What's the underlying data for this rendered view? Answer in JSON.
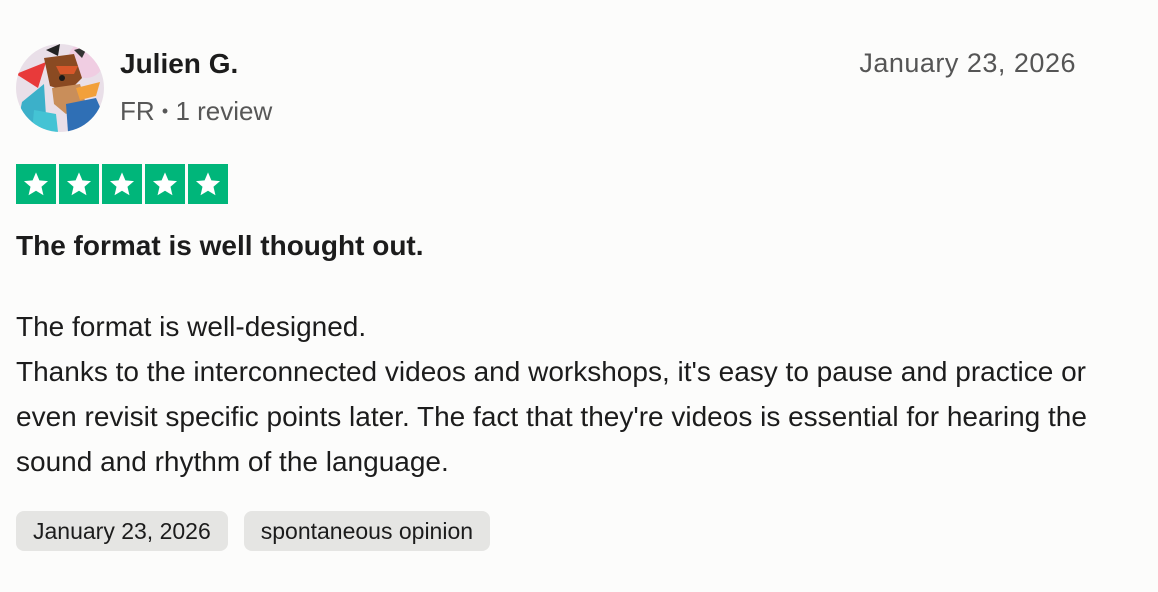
{
  "reviewer": {
    "name": "Julien G.",
    "country": "FR",
    "separator": "•",
    "review_count": "1 review"
  },
  "review": {
    "date": "January 23, 2026",
    "rating": 5,
    "rating_max": 5,
    "star_color": "#00b67a",
    "title": "The format is well thought out.",
    "body_lines": [
      "The format is well-designed.",
      "Thanks to the interconnected videos and workshops, it's easy to pause and practice or even revisit specific points later. The fact that they're videos is essential for hearing the sound and rhythm of the language."
    ]
  },
  "tags": [
    {
      "label": "January 23, 2026"
    },
    {
      "label": "spontaneous opinion"
    }
  ],
  "icons": {
    "star": "star-icon",
    "avatar": "avatar-image"
  }
}
